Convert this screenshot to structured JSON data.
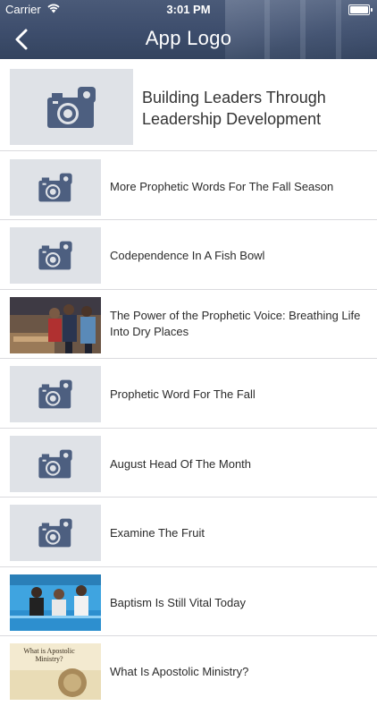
{
  "status_bar": {
    "carrier": "Carrier",
    "time": "3:01 PM"
  },
  "nav": {
    "title": "App Logo"
  },
  "featured": {
    "title": "Building Leaders Through Leadership Development",
    "thumbnail": "camera-placeholder-icon"
  },
  "items": [
    {
      "title": "More Prophetic Words For The Fall Season",
      "thumbnail": "camera-placeholder-icon"
    },
    {
      "title": "Codependence In A Fish Bowl",
      "thumbnail": "camera-placeholder-icon"
    },
    {
      "title": "The Power of the Prophetic Voice: Breathing Life Into Dry Places",
      "thumbnail": "photo-people-praying"
    },
    {
      "title": "Prophetic Word For The Fall",
      "thumbnail": "camera-placeholder-icon"
    },
    {
      "title": "August Head Of The Month",
      "thumbnail": "camera-placeholder-icon"
    },
    {
      "title": "Examine The Fruit",
      "thumbnail": "camera-placeholder-icon"
    },
    {
      "title": "Baptism Is Still Vital Today",
      "thumbnail": "photo-baptism-pool"
    },
    {
      "title": "What Is Apostolic Ministry?",
      "thumbnail": "photo-book-what-is-apostolic-ministry",
      "thumbnail_text": "What is Apostolic Ministry?"
    }
  ],
  "colors": {
    "header": "#3d4d6c",
    "placeholder_bg": "#dfe2e7",
    "camera_icon": "#4d5f80",
    "separator": "#dadade"
  }
}
